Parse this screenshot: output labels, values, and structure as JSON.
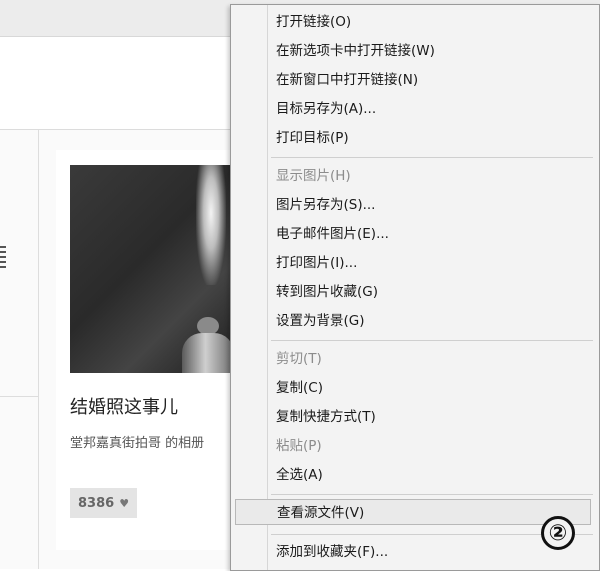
{
  "background_page": {
    "card": {
      "title": "结婚照这事儿",
      "subtitle": "堂邦嘉真街拍哥 的相册",
      "likes": "8386",
      "heart_glyph": "♥"
    }
  },
  "context_menu": {
    "groups": [
      [
        {
          "label": "打开链接(O)",
          "enabled": true
        },
        {
          "label": "在新选项卡中打开链接(W)",
          "enabled": true
        },
        {
          "label": "在新窗口中打开链接(N)",
          "enabled": true
        },
        {
          "label": "目标另存为(A)...",
          "enabled": true
        },
        {
          "label": "打印目标(P)",
          "enabled": true
        }
      ],
      [
        {
          "label": "显示图片(H)",
          "enabled": false
        },
        {
          "label": "图片另存为(S)...",
          "enabled": true
        },
        {
          "label": "电子邮件图片(E)...",
          "enabled": true
        },
        {
          "label": "打印图片(I)...",
          "enabled": true
        },
        {
          "label": "转到图片收藏(G)",
          "enabled": true
        },
        {
          "label": "设置为背景(G)",
          "enabled": true
        }
      ],
      [
        {
          "label": "剪切(T)",
          "enabled": false
        },
        {
          "label": "复制(C)",
          "enabled": true
        },
        {
          "label": "复制快捷方式(T)",
          "enabled": true
        },
        {
          "label": "粘贴(P)",
          "enabled": false
        },
        {
          "label": "全选(A)",
          "enabled": true
        }
      ],
      [
        {
          "label": "查看源文件(V)",
          "enabled": true,
          "highlighted": true
        }
      ],
      [
        {
          "label": "添加到收藏夹(F)...",
          "enabled": true
        }
      ]
    ]
  },
  "annotation": {
    "step_label": "②"
  }
}
